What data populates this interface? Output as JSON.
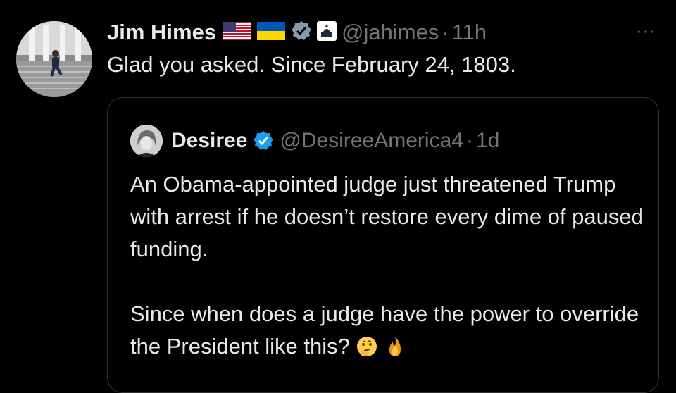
{
  "tweet": {
    "author_name": "Jim Himes",
    "handle": "@jahimes",
    "time": "11h",
    "separator": "·",
    "text": "Glad you asked.  Since February 24, 1803.",
    "more_label": "···"
  },
  "quote": {
    "author_name": "Desiree",
    "handle": "@DesireeAmerica4",
    "time": "1d",
    "separator": "·",
    "paragraph1": "An Obama-appointed judge just threatened Trump with arrest if he doesn’t restore every dime of paused funding.",
    "paragraph2": "Since when does a judge have the power to override the President like this?"
  },
  "colors": {
    "background": "#000000",
    "text": "#e7e9ea",
    "muted": "#71767b",
    "border": "#2f3336",
    "verified_blue": "#1d9bf0",
    "gray_badge": "#829aab"
  },
  "icons": {
    "us_flag": "us-flag-icon",
    "ukraine_flag": "ukraine-flag-icon",
    "gov_verified": "gray-verified-badge-icon",
    "capitol": "capitol-affiliate-icon",
    "blue_verified": "blue-verified-badge-icon",
    "thinking": "thinking-face-emoji",
    "fire": "fire-emoji"
  }
}
